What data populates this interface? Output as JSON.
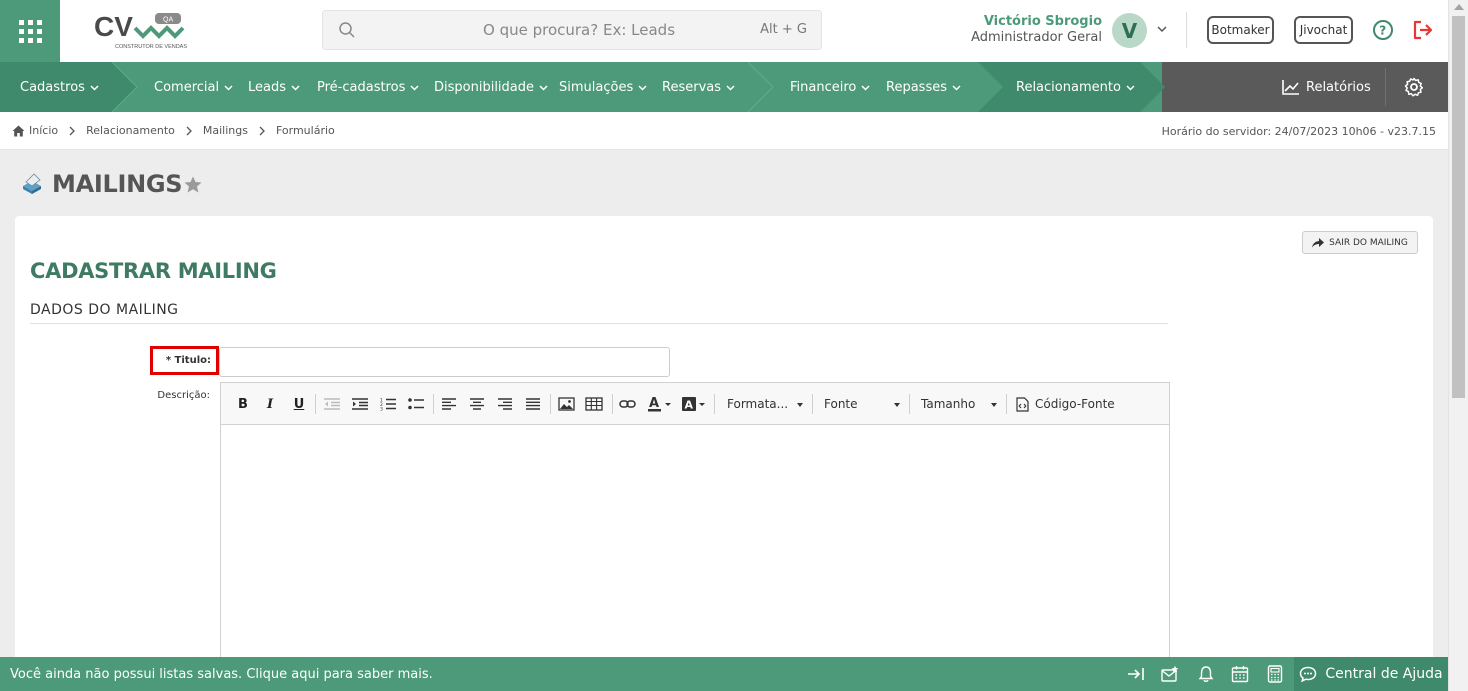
{
  "header": {
    "logo_text": "CV",
    "logo_tag": "QA",
    "logo_sub": "CONSTRUTOR DE VENDAS",
    "search_placeholder": "O que procura? Ex: Leads",
    "search_shortcut": "Alt + G",
    "user_name": "Victório Sbrogio",
    "user_role": "Administrador Geral",
    "avatar_initial": "V",
    "botmaker_label": "Botmaker",
    "jivochat_label": "Jivochat"
  },
  "nav": {
    "items": [
      {
        "label": "Cadastros"
      },
      {
        "label": "Comercial"
      },
      {
        "label": "Leads"
      },
      {
        "label": "Pré-cadastros"
      },
      {
        "label": "Disponibilidade"
      },
      {
        "label": "Simulações"
      },
      {
        "label": "Reservas"
      },
      {
        "label": "Financeiro"
      },
      {
        "label": "Repasses"
      },
      {
        "label": "Relacionamento"
      }
    ],
    "reports_label": "Relatórios"
  },
  "breadcrumb": {
    "items": [
      "Início",
      "Relacionamento",
      "Mailings",
      "Formulário"
    ],
    "server_time": "Horário do servidor: 24/07/2023 10h06 - v23.7.15"
  },
  "page": {
    "title": "MAILINGS",
    "exit_button": "SAIR DO MAILING",
    "form_title": "CADASTRAR MAILING",
    "section_title": "DADOS DO MAILING",
    "title_label": "* Titulo:",
    "title_value": "",
    "description_label": "Descrição:"
  },
  "editor": {
    "format_label": "Formata...",
    "font_label": "Fonte",
    "size_label": "Tamanho",
    "source_label": "Código-Fonte"
  },
  "footer": {
    "message": "Você ainda não possui listas salvas. Clique aqui para saber mais.",
    "help_label": "Central de Ajuda"
  },
  "colors": {
    "brand": "#4d9a7a",
    "brand_dark": "#3f8a6c",
    "title_green": "#3f7a63",
    "highlight_red": "#e00000",
    "logout_red": "#e53935"
  }
}
